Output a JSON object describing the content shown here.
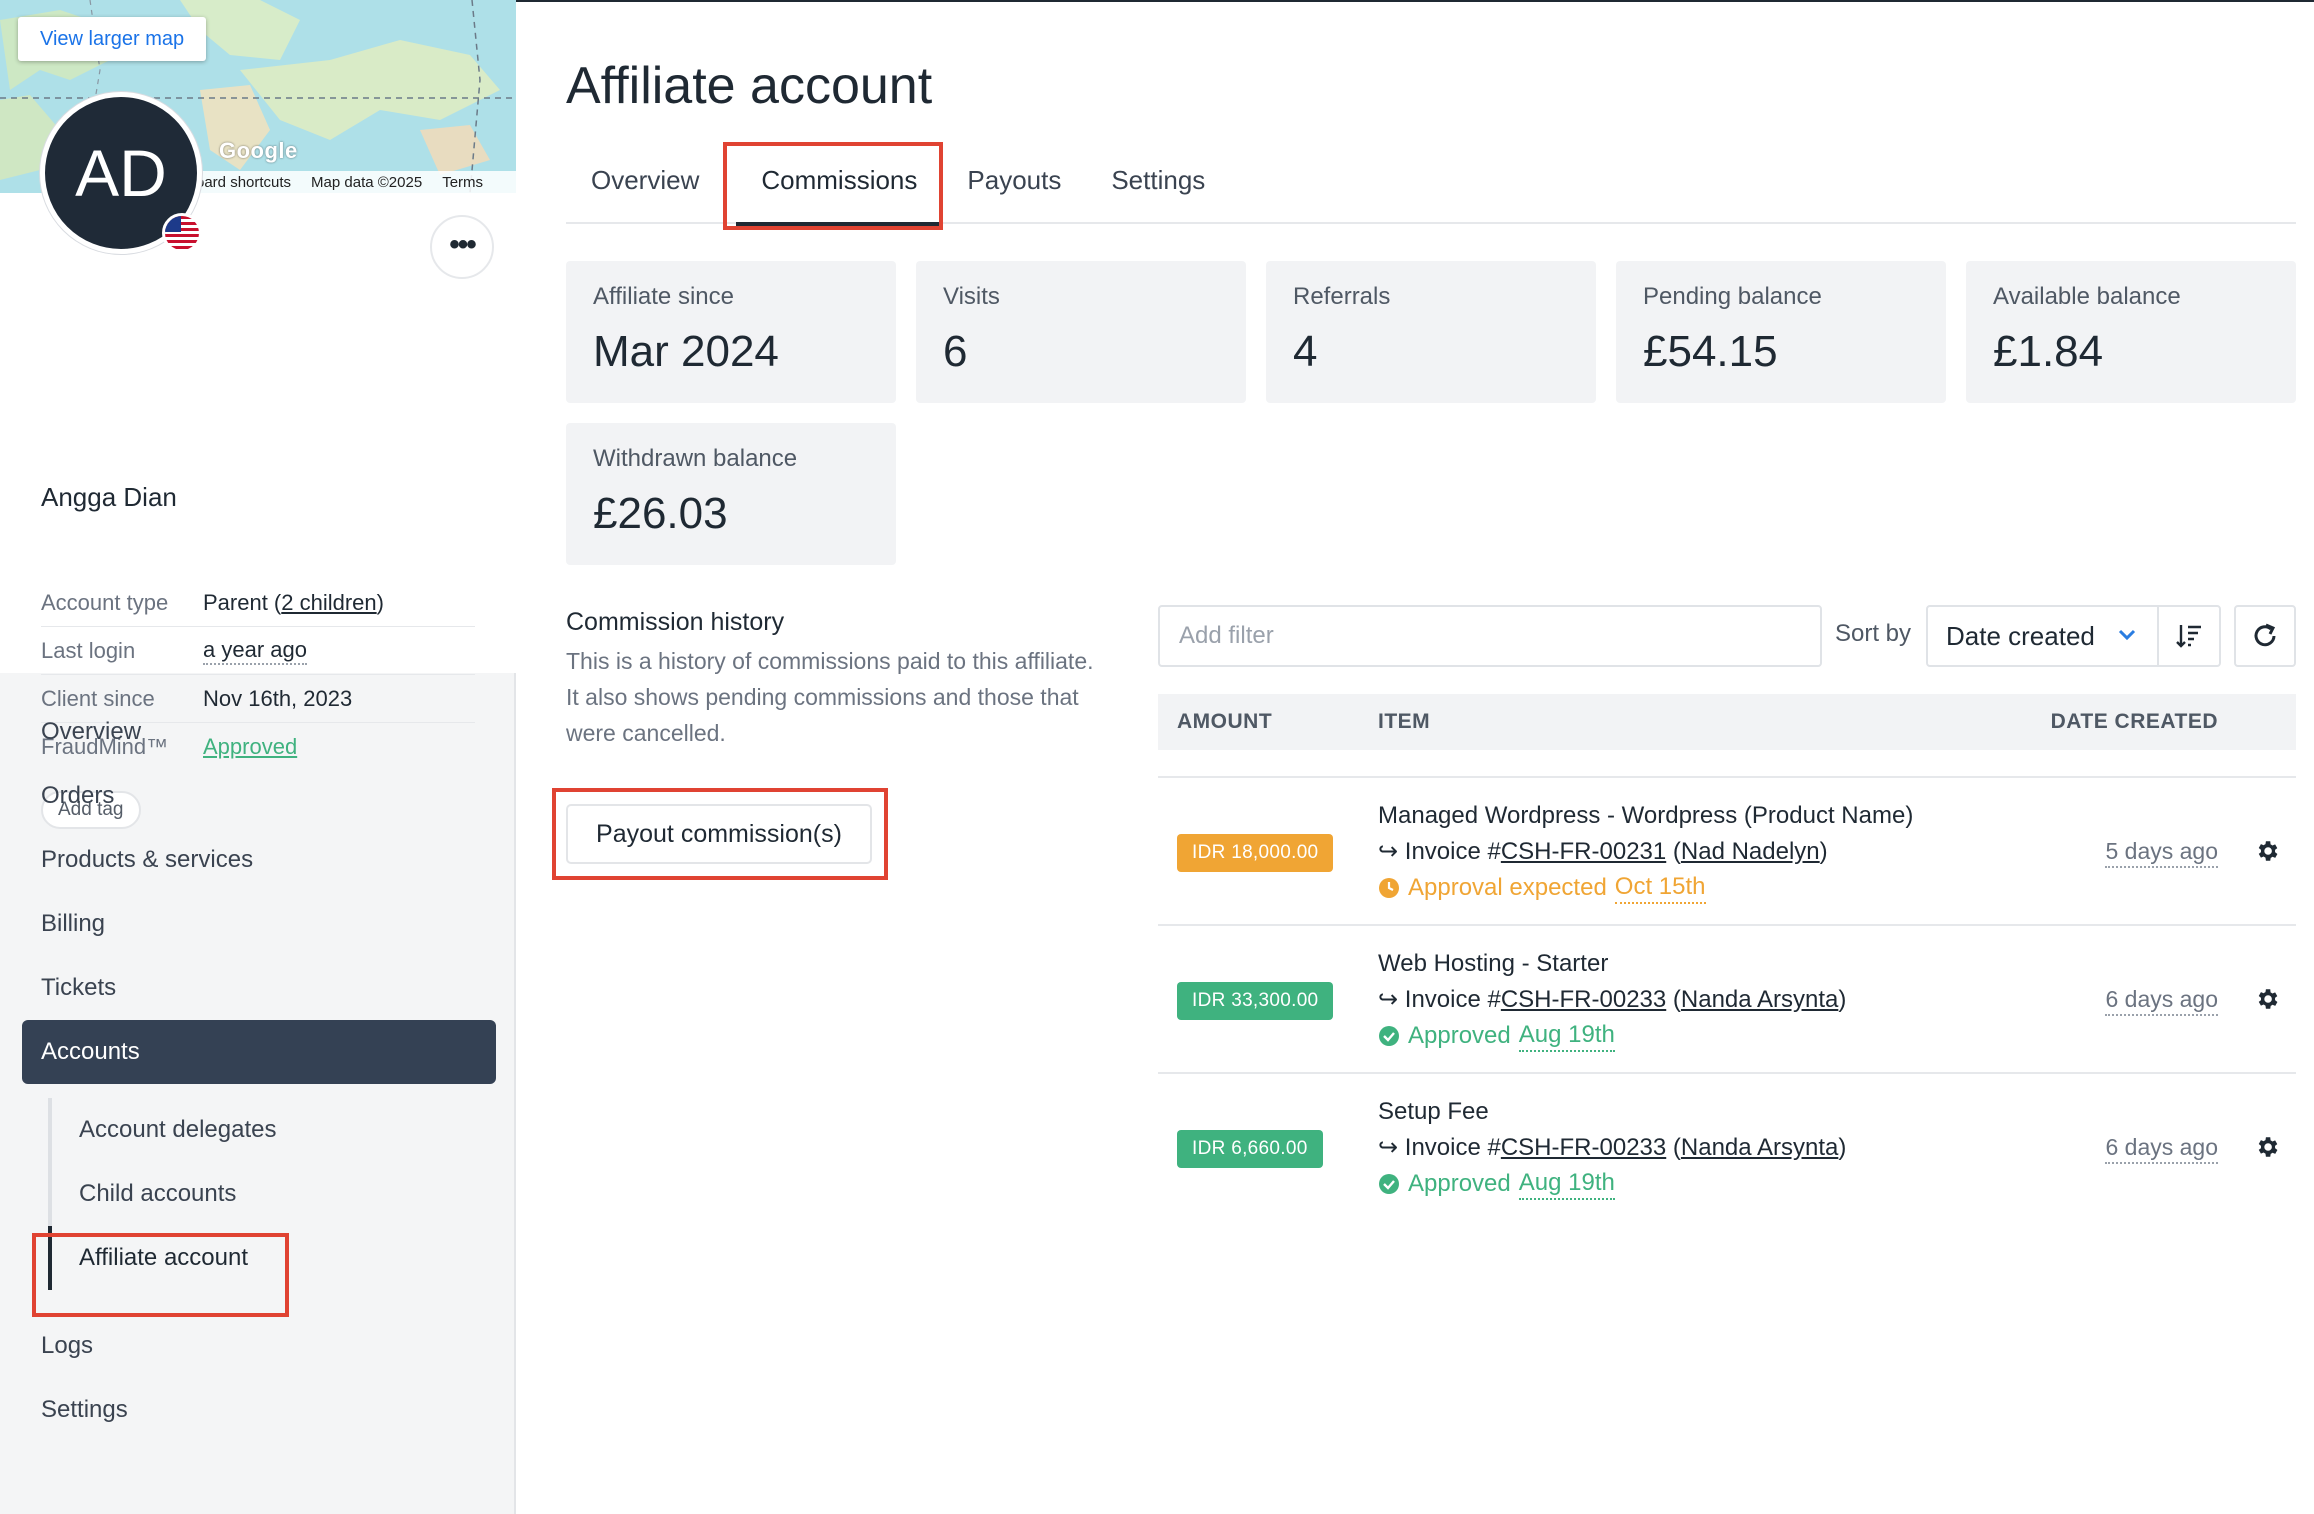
{
  "map": {
    "view_larger": "View larger map",
    "google": "Google",
    "footer": [
      "oard shortcuts",
      "Map data ©2025",
      "Terms"
    ]
  },
  "profile": {
    "initials": "AD",
    "name": "Angga Dian",
    "more_icon": "more-horizontal-icon",
    "info": [
      {
        "label": "Account type",
        "value_prefix": "Parent (",
        "value_link": "2 children",
        "value_suffix": ")"
      },
      {
        "label": "Last login",
        "value": "a year ago"
      },
      {
        "label": "Client since",
        "value": "Nov 16th, 2023"
      },
      {
        "label": "FraudMind™",
        "value": "Approved",
        "color": "#3fb27f"
      }
    ],
    "add_tag": "Add tag"
  },
  "nav": {
    "items": [
      "Overview",
      "Orders",
      "Products & services",
      "Billing",
      "Tickets"
    ],
    "active": "Accounts",
    "sub": [
      "Account delegates",
      "Child accounts",
      "Affiliate account"
    ],
    "after": [
      "Logs",
      "Settings"
    ]
  },
  "page": {
    "title": "Affiliate account",
    "tabs": [
      "Overview",
      "Commissions",
      "Payouts",
      "Settings"
    ],
    "active_tab": "Commissions"
  },
  "stats": [
    {
      "label": "Affiliate since",
      "value": "Mar 2024"
    },
    {
      "label": "Visits",
      "value": "6"
    },
    {
      "label": "Referrals",
      "value": "4"
    },
    {
      "label": "Pending balance",
      "value": "£54.15"
    },
    {
      "label": "Available balance",
      "value": "£1.84"
    },
    {
      "label": "Withdrawn balance",
      "value": "£26.03"
    }
  ],
  "history": {
    "title": "Commission history",
    "description": "This is a history of commissions paid to this affiliate. It also shows pending commissions and those that were cancelled.",
    "payout_button": "Payout commission(s)"
  },
  "toolbar": {
    "filter_placeholder": "Add filter",
    "sort_label": "Sort by",
    "sort_value": "Date created"
  },
  "table": {
    "headers": [
      "AMOUNT",
      "ITEM",
      "DATE CREATED"
    ],
    "rows": [
      {
        "amount": "IDR 18,000.00",
        "amount_color": "#f0a534",
        "item": "Managed Wordpress - Wordpress (Product Name)",
        "invoice_prefix": "Invoice #",
        "invoice": "CSH-FR-00231",
        "client": "Nad Nadelyn",
        "status_text": "Approval expected",
        "status_date": "Oct 15th",
        "status_color": "#f0a534",
        "status_icon": "clock-icon",
        "date": "5 days ago"
      },
      {
        "amount": "IDR 33,300.00",
        "amount_color": "#3fb27f",
        "item": "Web Hosting - Starter",
        "invoice_prefix": "Invoice #",
        "invoice": "CSH-FR-00233",
        "client": "Nanda Arsynta",
        "status_text": "Approved",
        "status_date": "Aug 19th",
        "status_color": "#3fb27f",
        "status_icon": "check-circle-icon",
        "date": "6 days ago"
      },
      {
        "amount": "IDR 6,660.00",
        "amount_color": "#3fb27f",
        "item": "Setup Fee",
        "invoice_prefix": "Invoice #",
        "invoice": "CSH-FR-00233",
        "client": "Nanda Arsynta",
        "status_text": "Approved",
        "status_date": "Aug 19th",
        "status_color": "#3fb27f",
        "status_icon": "check-circle-icon",
        "date": "6 days ago"
      }
    ]
  }
}
